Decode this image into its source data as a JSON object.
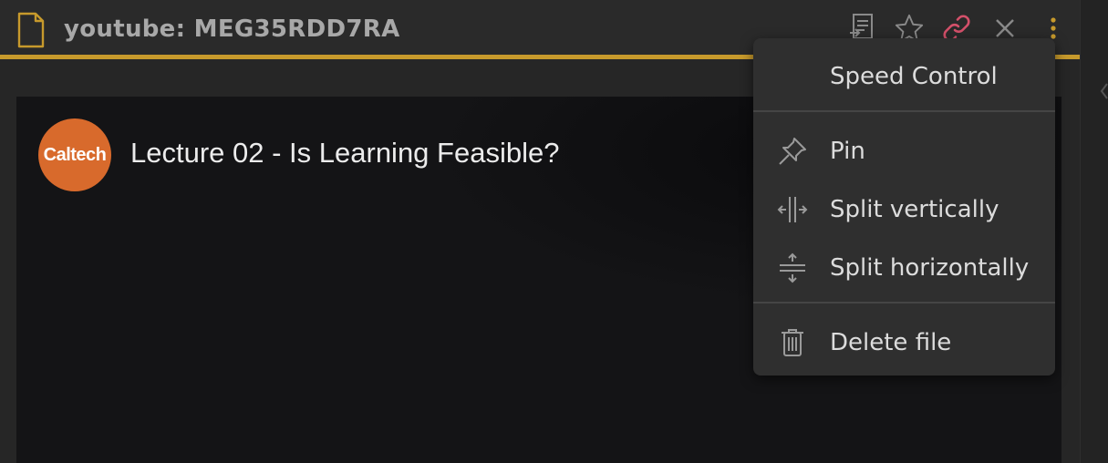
{
  "view": {
    "title": "youtube: MEG35RDD7RA",
    "icons": {
      "file": "file-icon",
      "reading_view": "reading-view-icon",
      "bookmark": "star-icon",
      "link": "link-icon",
      "close": "close-icon",
      "more": "more-options-icon"
    },
    "accent_color": "#c79a2c",
    "link_icon_color": "#d4506a"
  },
  "video": {
    "channel_logo_text": "Caltech",
    "channel_logo_color": "#d86a2c",
    "title": "Lecture 02 - Is Learning Feasible?"
  },
  "menu": {
    "speed_control": "Speed Control",
    "pin": "Pin",
    "split_vertically": "Split vertically",
    "split_horizontally": "Split horizontally",
    "delete_file": "Delete file"
  }
}
